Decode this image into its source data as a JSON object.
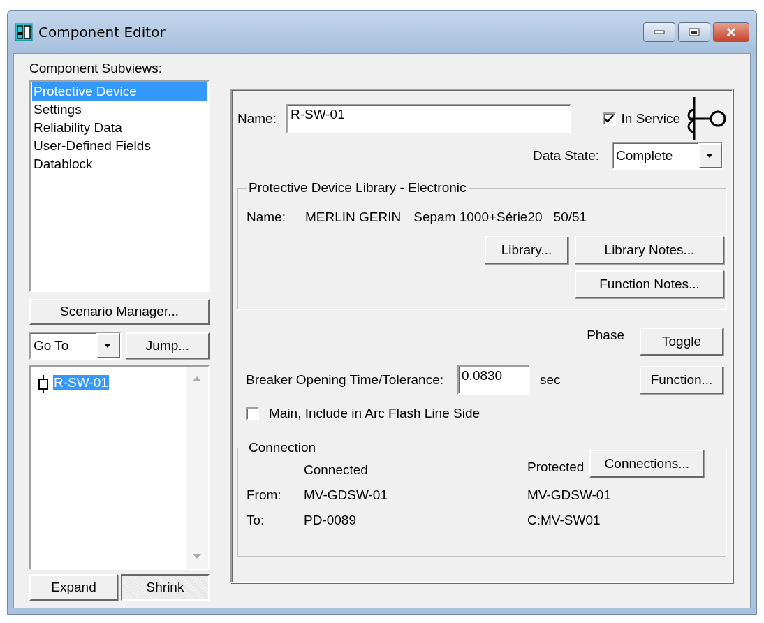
{
  "window": {
    "title": "Component Editor"
  },
  "subviews": {
    "label": "Component Subviews:",
    "items": [
      {
        "label": "Protective Device",
        "selected": true
      },
      {
        "label": "Settings",
        "selected": false
      },
      {
        "label": "Reliability Data",
        "selected": false
      },
      {
        "label": "User-Defined Fields",
        "selected": false
      },
      {
        "label": "Datablock",
        "selected": false
      }
    ]
  },
  "scenario_button": "Scenario Manager...",
  "goto": {
    "value": "Go To"
  },
  "jump_button": "Jump...",
  "tree": [
    {
      "label": "R-SW-01",
      "selected": true
    }
  ],
  "bottom_buttons": [
    {
      "label": "Expand",
      "pressed": false
    },
    {
      "label": "Shrink",
      "pressed": true
    }
  ],
  "name": {
    "label": "Name:",
    "value": "R-SW-01"
  },
  "in_service": {
    "label": "In Service",
    "checked": true
  },
  "data_state": {
    "label": "Data State:",
    "value": "Complete"
  },
  "library": {
    "title": "Protective Device Library - Electronic",
    "name_label": "Name:",
    "manufacturer": "MERLIN GERIN",
    "model": "Sepam 1000+Série20",
    "function": "50/51",
    "buttons": [
      "Library...",
      "Library Notes...",
      "Function Notes..."
    ]
  },
  "phase": {
    "label": "Phase",
    "button": "Toggle"
  },
  "breaker": {
    "label": "Breaker Opening Time/Tolerance:",
    "value": "0.0830",
    "unit": "sec",
    "button": "Function..."
  },
  "arc_flash": {
    "label": "Main, Include in Arc Flash Line Side",
    "checked": false
  },
  "connection": {
    "title": "Connection",
    "button": "Connections...",
    "connected_header": "Connected",
    "protected_header": "Protected",
    "rows": [
      {
        "label": "From:",
        "connected": "MV-GDSW-01",
        "protected": "MV-GDSW-01"
      },
      {
        "label": "To:",
        "connected": "PD-0089",
        "protected": "C:MV-SW01"
      }
    ]
  }
}
